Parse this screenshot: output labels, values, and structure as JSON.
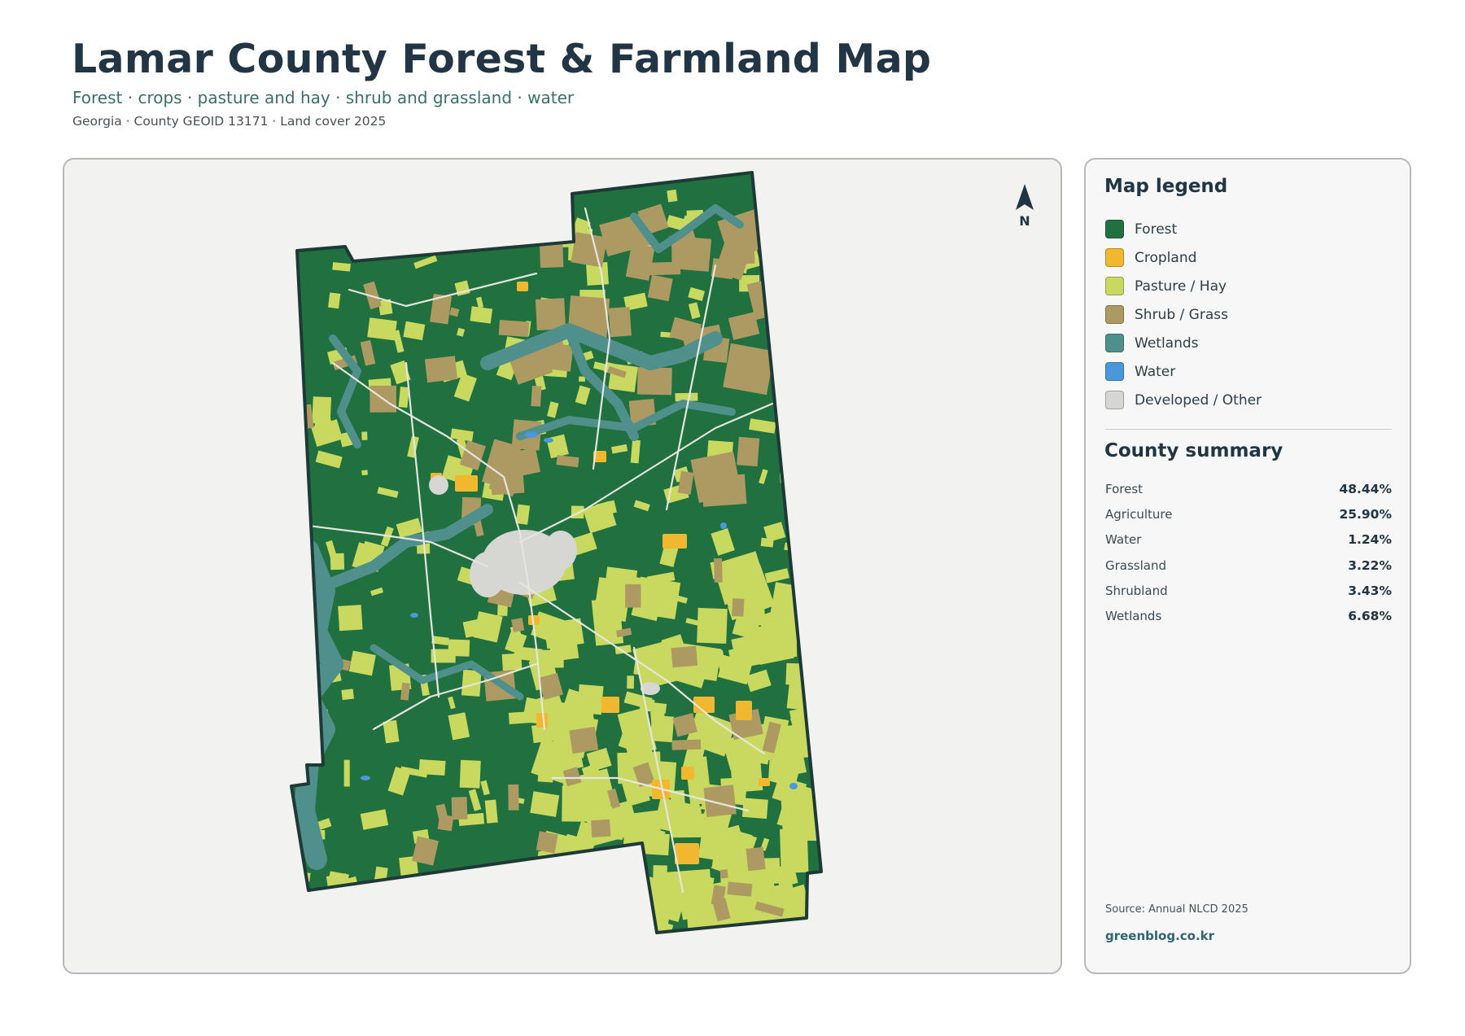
{
  "header": {
    "title": "Lamar County Forest & Farmland Map",
    "subtitle": "Forest · crops · pasture and hay · shrub and grassland · water",
    "meta": "Georgia · County GEOID 13171 · Land cover 2025"
  },
  "map": {
    "north_label": "N",
    "colors": {
      "forest": "#21703f",
      "cropland": "#f0b72f",
      "pasture": "#c9d960",
      "shrub": "#ad9a63",
      "wetlands": "#4f8f8c",
      "water": "#4a97d9",
      "developed": "#d6d6d2",
      "outline": "#1e3a36"
    }
  },
  "legend": {
    "title": "Map legend",
    "items": [
      {
        "label": "Forest",
        "color": "#21703f"
      },
      {
        "label": "Cropland",
        "color": "#f0b72f"
      },
      {
        "label": "Pasture / Hay",
        "color": "#c9d960"
      },
      {
        "label": "Shrub / Grass",
        "color": "#ad9a63"
      },
      {
        "label": "Wetlands",
        "color": "#4f8f8c"
      },
      {
        "label": "Water",
        "color": "#4a97d9"
      },
      {
        "label": "Developed / Other",
        "color": "#d6d6d2"
      }
    ]
  },
  "summary": {
    "title": "County summary",
    "rows": [
      {
        "label": "Forest",
        "value": "48.44%"
      },
      {
        "label": "Agriculture",
        "value": "25.90%"
      },
      {
        "label": "Water",
        "value": "1.24%"
      },
      {
        "label": "Grassland",
        "value": "3.22%"
      },
      {
        "label": "Shrubland",
        "value": "3.43%"
      },
      {
        "label": "Wetlands",
        "value": "6.68%"
      }
    ]
  },
  "footer": {
    "source": "Source: Annual NLCD 2025",
    "site": "greenblog.co.kr"
  }
}
